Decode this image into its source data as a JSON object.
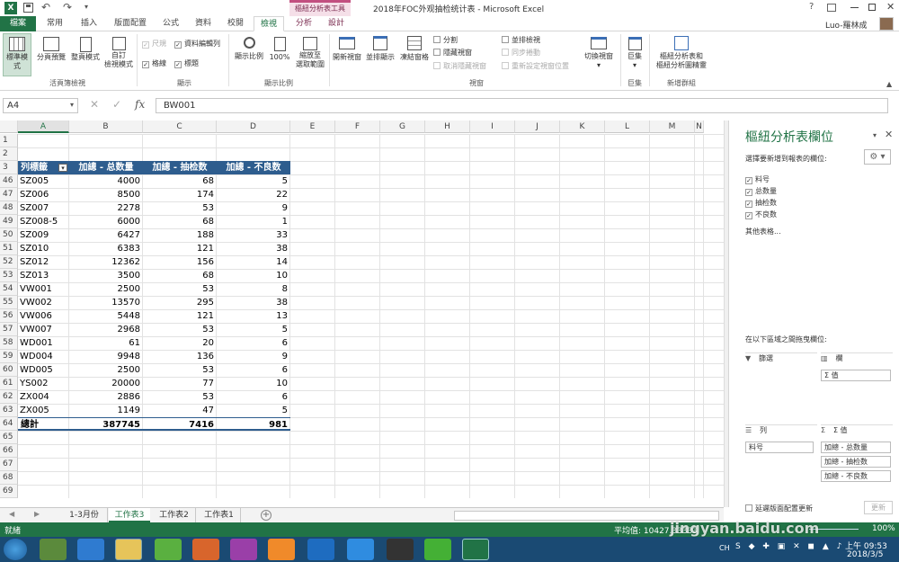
{
  "window": {
    "title": "2018年FOC外观抽检统计表 - Microsoft Excel",
    "context_tab": "樞紐分析表工具",
    "user": "Luo-羅林成",
    "help": "?"
  },
  "tabs": [
    "檔案",
    "常用",
    "插入",
    "版面配置",
    "公式",
    "資料",
    "校閱",
    "檢視",
    "分析",
    "設計"
  ],
  "ribbon": {
    "view_buttons": [
      "標準模式",
      "分頁預覽",
      "整頁模式",
      "自訂\n檢視模式"
    ],
    "show_checks": [
      {
        "label": "尺規",
        "checked": true,
        "disabled": true
      },
      {
        "label": "資料編輯列",
        "checked": true
      },
      {
        "label": "格線",
        "checked": true
      },
      {
        "label": "標題",
        "checked": true
      }
    ],
    "zoom_buttons": [
      "顯示比例",
      "100%",
      "縮放至\n選取範圍"
    ],
    "window_buttons": [
      "開新視窗",
      "並排顯示",
      "凍結窗格"
    ],
    "window_small": [
      "分割",
      "隱藏視窗",
      "取消隱藏視窗"
    ],
    "window_small2": [
      "並排檢視",
      "同步捲動",
      "重新設定視窗位置"
    ],
    "switch": "切換視窗",
    "macro": "巨集",
    "new_group": "樞紐分析表和\n樞紐分析圖精靈",
    "groups": [
      "活頁簿檢視",
      "顯示",
      "顯示比例",
      "視窗",
      "巨集",
      "新增群組"
    ]
  },
  "formula": {
    "namebox": "A4",
    "fx": "fx",
    "value": "BW001"
  },
  "columns": [
    "A",
    "B",
    "C",
    "D",
    "E",
    "F",
    "G",
    "H",
    "I",
    "J",
    "K",
    "L",
    "M",
    "N"
  ],
  "pivot": {
    "headers": [
      "列標籤",
      "加總 - 总数量",
      "加總 - 抽检数",
      "加總 - 不良数"
    ],
    "rows": [
      [
        "46",
        "SZ005",
        "4000",
        "68",
        "5"
      ],
      [
        "47",
        "SZ006",
        "8500",
        "174",
        "22"
      ],
      [
        "48",
        "SZ007",
        "2278",
        "53",
        "9"
      ],
      [
        "49",
        "SZ008-5",
        "6000",
        "68",
        "1"
      ],
      [
        "50",
        "SZ009",
        "6427",
        "188",
        "33"
      ],
      [
        "51",
        "SZ010",
        "6383",
        "121",
        "38"
      ],
      [
        "52",
        "SZ012",
        "12362",
        "156",
        "14"
      ],
      [
        "53",
        "SZ013",
        "3500",
        "68",
        "10"
      ],
      [
        "54",
        "VW001",
        "2500",
        "53",
        "8"
      ],
      [
        "55",
        "VW002",
        "13570",
        "295",
        "38"
      ],
      [
        "56",
        "VW006",
        "5448",
        "121",
        "13"
      ],
      [
        "57",
        "VW007",
        "2968",
        "53",
        "5"
      ],
      [
        "58",
        "WD001",
        "61",
        "20",
        "6"
      ],
      [
        "59",
        "WD004",
        "9948",
        "136",
        "9"
      ],
      [
        "60",
        "WD005",
        "2500",
        "53",
        "6"
      ],
      [
        "61",
        "YS002",
        "20000",
        "77",
        "10"
      ],
      [
        "62",
        "ZX004",
        "2886",
        "53",
        "6"
      ],
      [
        "63",
        "ZX005",
        "1149",
        "47",
        "5"
      ]
    ],
    "total": [
      "64",
      "總計",
      "387745",
      "7416",
      "981"
    ]
  },
  "top_rows": [
    "1",
    "2",
    "3"
  ],
  "empty_rows": [
    "65",
    "66",
    "67",
    "68",
    "69"
  ],
  "sheets": [
    "1-3月份",
    "工作表3",
    "工作表2",
    "工作表1"
  ],
  "active_sheet": "工作表3",
  "status": {
    "ready": "就緒",
    "average": "平均值: 10427.33333",
    "zoom": "100%"
  },
  "pane": {
    "title": "樞紐分析表欄位",
    "choose": "選擇要新增到報表的欄位:",
    "fields": [
      "料号",
      "总数量",
      "抽检数",
      "不良数"
    ],
    "more": "其他表格...",
    "drag": "在以下區域之間拖曳欄位:",
    "filters": "篩選",
    "columns": "欄",
    "columns_item": "Σ 值",
    "rows_area": "列",
    "values": "Σ 值",
    "rows_item": "料号",
    "values_items": [
      "加總 - 总数量",
      "加總 - 抽检数",
      "加總 - 不良数"
    ],
    "defer": "延遲版面配置更新",
    "update": "更新"
  },
  "taskbar": {
    "time": "上午 09:53",
    "date": "2018/3/5",
    "lang": "CH"
  },
  "watermark": "jingyan.baidu.com",
  "colors": {
    "excel_green": "#217346",
    "pivot_header": "#2e5d8e",
    "taskbar": "#1a4a73"
  }
}
